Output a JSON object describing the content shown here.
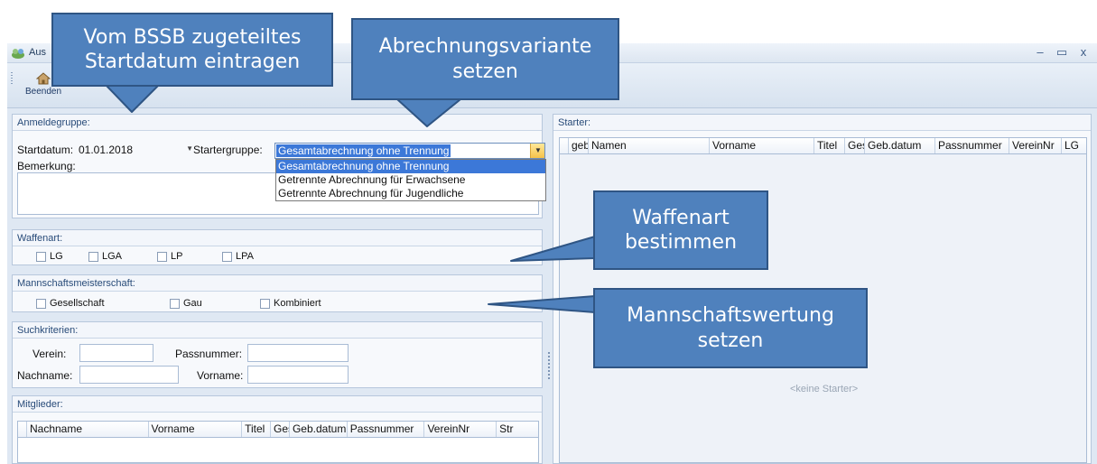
{
  "window": {
    "title": "Aus"
  },
  "window_controls": {
    "minimize": "–",
    "maximize": "▭",
    "close": "x"
  },
  "toolbar": {
    "beenden_label": "Beenden"
  },
  "anmeldegruppe": {
    "header": "Anmeldegruppe:",
    "startdatum_label": "Startdatum:",
    "startdatum_value": "01.01.2018",
    "startergruppe_label": "Startergruppe:",
    "startergruppe_value": "Gesamtabrechnung ohne Trennung",
    "options": [
      "Gesamtabrechnung ohne Trennung",
      "Getrennte Abrechnung für Erwachsene",
      "Getrennte Abrechnung für Jugendliche"
    ],
    "bemerkung_label": "Bemerkung:"
  },
  "waffenart": {
    "header": "Waffenart:",
    "options": [
      "LG",
      "LGA",
      "LP",
      "LPA"
    ]
  },
  "mannschaft": {
    "header": "Mannschaftsmeisterschaft:",
    "options": [
      "Gesellschaft",
      "Gau",
      "Kombiniert"
    ]
  },
  "suche": {
    "header": "Suchkriterien:",
    "verein_label": "Verein:",
    "passnummer_label": "Passnummer:",
    "nachname_label": "Nachname:",
    "vorname_label": "Vorname:"
  },
  "mitglieder": {
    "header": "Mitglieder:",
    "columns": [
      "Nachname",
      "Vorname",
      "Titel",
      "Ges",
      "Geb.datum",
      "Passnummer",
      "VereinNr",
      "Str"
    ]
  },
  "starter": {
    "header": "Starter:",
    "columns": [
      "geb",
      "Namen",
      "Vorname",
      "Titel",
      "Ges",
      "Geb.datum",
      "Passnummer",
      "VereinNr",
      "LG"
    ],
    "empty_text": "<keine Starter>"
  },
  "callouts": {
    "startdatum": "Vom BSSB zugeteiltes Startdatum eintragen",
    "abrechnung": "Abrechnungsvariante setzen",
    "waffenart": "Waffenart bestimmen",
    "mannschaft": "Mannschaftswertung setzen"
  },
  "colors": {
    "callout_fill": "#4f81bd",
    "callout_border": "#2f5584",
    "selection": "#3c78d8"
  }
}
